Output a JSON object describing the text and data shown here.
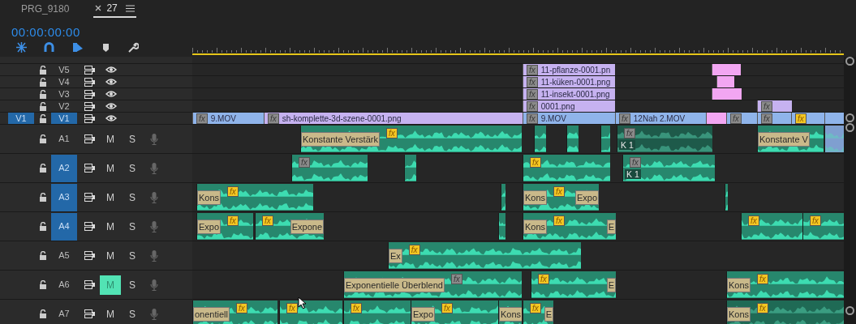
{
  "tabs": [
    {
      "label": "PRG_9180",
      "selected": false
    },
    {
      "label": "27",
      "selected": true
    }
  ],
  "timecode": "00:00:00:00",
  "tools": [
    {
      "kind": "nest",
      "on": true
    },
    {
      "kind": "snap",
      "on": true
    },
    {
      "kind": "linked",
      "on": true
    },
    {
      "kind": "marker",
      "on": false
    },
    {
      "kind": "settings",
      "on": false
    }
  ],
  "video_tracks": [
    {
      "name": "V5",
      "targeted": false,
      "locked": false,
      "visible": true,
      "clips": [
        {
          "kind": "image",
          "name": "11-pflanze-0001.pn",
          "effect": {
            "label": "fx",
            "applied": false
          }
        },
        {
          "kind": "overlay"
        }
      ]
    },
    {
      "name": "V4",
      "targeted": false,
      "locked": false,
      "visible": true,
      "clips": [
        {
          "kind": "image",
          "name": "11-küken-0001.png",
          "effect": {
            "label": "fx",
            "applied": false
          }
        },
        {
          "kind": "overlay"
        }
      ]
    },
    {
      "name": "V3",
      "targeted": false,
      "locked": false,
      "visible": true,
      "clips": [
        {
          "kind": "image",
          "name": "11-insekt-0001.png",
          "effect": {
            "label": "fx",
            "applied": false
          }
        },
        {
          "kind": "overlay"
        }
      ]
    },
    {
      "name": "V2",
      "targeted": false,
      "locked": false,
      "visible": true,
      "clips": [
        {
          "kind": "image",
          "name": "0001.png",
          "effect": {
            "label": "fx",
            "applied": false
          }
        },
        {
          "kind": "image",
          "effect": {
            "label": "fx",
            "applied": false
          }
        }
      ]
    },
    {
      "name": "V1",
      "source": "V1",
      "targeted": true,
      "locked": false,
      "visible": true,
      "clips": [
        {
          "kind": "video",
          "name": "9.MOV",
          "effect": {
            "label": "fx",
            "applied": false
          }
        },
        {
          "kind": "image",
          "name": "sh-komplette-3d-szene-0001.png",
          "effect": {
            "label": "fx",
            "applied": false
          }
        },
        {
          "kind": "video",
          "name": "9.MOV",
          "effect": {
            "label": "fx",
            "applied": false
          }
        },
        {
          "kind": "video",
          "name": "12Nah  2.MOV",
          "effect": {
            "label": "fx",
            "applied": false
          }
        },
        {
          "kind": "overlay"
        },
        {
          "kind": "video",
          "effect": {
            "label": "fx",
            "applied": false
          }
        },
        {
          "kind": "video",
          "effect": {
            "label": "fx",
            "applied": false
          }
        },
        {
          "kind": "video",
          "effect": {
            "label": "fx",
            "applied": true
          }
        },
        {
          "kind": "video"
        }
      ]
    }
  ],
  "audio_tracks": [
    {
      "name": "A1",
      "targeted": false,
      "locked": false,
      "mute": {
        "label": "M",
        "on": false
      },
      "solo": {
        "label": "S",
        "on": false
      },
      "clips": [
        {
          "kind": "audio",
          "effect": {
            "label": "fx",
            "applied": true
          },
          "transition_in": "Konstante Verstärk"
        },
        {
          "kind": "audio"
        },
        {
          "kind": "audio"
        },
        {
          "kind": "audio"
        },
        {
          "kind": "audio",
          "color": "#1e5a4a",
          "name": "K 1",
          "effect": {
            "label": "fx",
            "applied": false
          }
        },
        {
          "kind": "audio",
          "transition_in": "Konstante V"
        },
        {
          "kind": "audio",
          "color": "#7f9fd0"
        }
      ]
    },
    {
      "name": "A2",
      "targeted": true,
      "locked": false,
      "mute": {
        "label": "M",
        "on": false
      },
      "solo": {
        "label": "S",
        "on": false
      },
      "clips": [
        {
          "kind": "audio",
          "effect": {
            "label": "fx",
            "applied": false
          }
        },
        {
          "kind": "audio"
        },
        {
          "kind": "audio",
          "effect": {
            "label": "fx",
            "applied": true
          }
        },
        {
          "kind": "audio",
          "name": "K 1",
          "effect": {
            "label": "fx",
            "applied": false
          }
        }
      ]
    },
    {
      "name": "A3",
      "targeted": true,
      "locked": false,
      "mute": {
        "label": "M",
        "on": false
      },
      "solo": {
        "label": "S",
        "on": false
      },
      "clips": [
        {
          "kind": "audio",
          "effect": {
            "label": "fx",
            "applied": true
          },
          "transition_in": "Kons"
        },
        {
          "kind": "audio"
        },
        {
          "kind": "audio",
          "effect": {
            "label": "fx",
            "applied": true
          },
          "transition_in": "Kons",
          "transition_out": "Expo"
        },
        {
          "kind": "audio"
        }
      ]
    },
    {
      "name": "A4",
      "targeted": true,
      "locked": false,
      "mute": {
        "label": "M",
        "on": false
      },
      "solo": {
        "label": "S",
        "on": false
      },
      "clips": [
        {
          "kind": "audio",
          "effect": {
            "label": "fx",
            "applied": true
          },
          "transition_in": "Expo"
        },
        {
          "kind": "audio",
          "effect": {
            "label": "fx",
            "applied": true
          },
          "transition_out": "Expone"
        },
        {
          "kind": "audio"
        },
        {
          "kind": "audio",
          "effect": {
            "label": "fx",
            "applied": true
          },
          "transition_in": "Kons",
          "transition_out": "E"
        },
        {
          "kind": "audio",
          "effect": {
            "label": "fx",
            "applied": true
          }
        },
        {
          "kind": "audio",
          "effect": {
            "label": "fx",
            "applied": true
          }
        }
      ]
    },
    {
      "name": "A5",
      "targeted": false,
      "locked": false,
      "mute": {
        "label": "M",
        "on": false
      },
      "solo": {
        "label": "S",
        "on": false
      },
      "clips": [
        {
          "kind": "audio",
          "effect": {
            "label": "fx",
            "applied": true
          },
          "transition_in": "Ex"
        }
      ]
    },
    {
      "name": "A6",
      "targeted": false,
      "locked": false,
      "mute": {
        "label": "M",
        "on": true
      },
      "solo": {
        "label": "S",
        "on": false
      },
      "clips": [
        {
          "kind": "audio",
          "effect": {
            "label": "fx",
            "applied": false
          },
          "transition_in": "Exponentielle Überblend"
        },
        {
          "kind": "audio",
          "effect": {
            "label": "fx",
            "applied": true
          },
          "transition_out": "E"
        },
        {
          "kind": "audio",
          "effect": {
            "label": "fx",
            "applied": true
          },
          "transition_in": "Kons"
        }
      ]
    },
    {
      "name": "A7",
      "targeted": false,
      "locked": false,
      "mute": {
        "label": "M",
        "on": false
      },
      "solo": {
        "label": "S",
        "on": false
      },
      "clips": [
        {
          "kind": "audio",
          "effect": {
            "label": "fx",
            "applied": true
          },
          "transition_in": "onentiell"
        },
        {
          "kind": "audio",
          "effect": {
            "label": "fx",
            "applied": true
          }
        },
        {
          "kind": "audio",
          "effect": {
            "label": "fx",
            "applied": true
          }
        },
        {
          "kind": "audio",
          "effect": {
            "label": "fx",
            "applied": true
          },
          "transition_in": "Expo"
        },
        {
          "kind": "audio",
          "transition_in": "Kons"
        },
        {
          "kind": "audio",
          "effect": {
            "label": "fx",
            "applied": true
          },
          "transition_out": "E"
        },
        {
          "kind": "audio",
          "color": "#1f6a55",
          "effect": {
            "label": "fx",
            "applied": true
          },
          "transition_in": "Kons"
        }
      ]
    }
  ]
}
